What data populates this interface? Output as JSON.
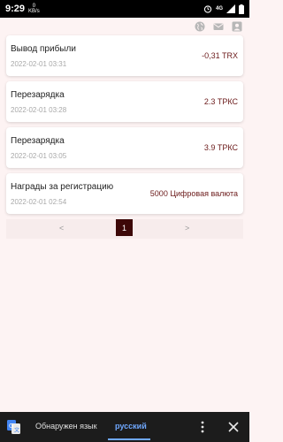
{
  "status_bar": {
    "time": "9:29",
    "speed_value": "0",
    "speed_unit": "KB/s",
    "network": "4G"
  },
  "header": {
    "icons": [
      "globe-icon",
      "mail-icon",
      "user-icon"
    ]
  },
  "records": [
    {
      "title": "Вывод прибыли",
      "date": "2022-02-01 03:31",
      "amount": "-0,31 TRX"
    },
    {
      "title": "Перезарядка",
      "date": "2022-02-01 03:28",
      "amount": "2.3 ТРКС"
    },
    {
      "title": "Перезарядка",
      "date": "2022-02-01 03:05",
      "amount": "3.9 ТРКС"
    },
    {
      "title": "Награды за регистрацию",
      "date": "2022-02-01 02:54",
      "amount": "5000 Цифровая валюта"
    }
  ],
  "pagination": {
    "prev": "<",
    "current": "1",
    "next": ">"
  },
  "translate_bar": {
    "detected_label": "Обнаружен язык",
    "language": "русский"
  },
  "colors": {
    "background": "#fdf3f3",
    "accent_dark": "#3d0808",
    "amount_text": "#6b1a1a",
    "translate_link": "#6fa8ff"
  }
}
